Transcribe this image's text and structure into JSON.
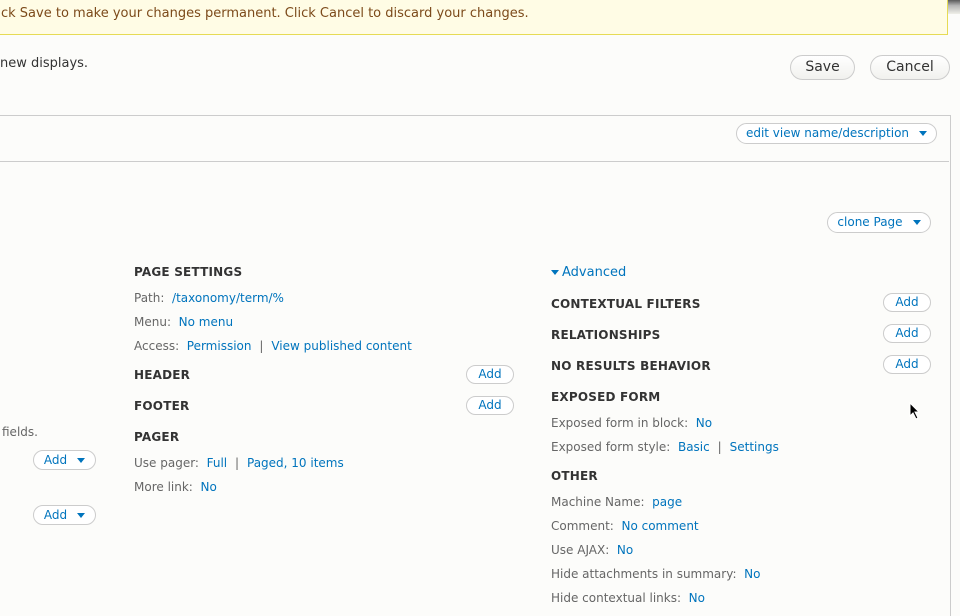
{
  "warning": "ck Save to make your changes permanent. Click Cancel to discard your changes.",
  "intro": "new displays.",
  "actions": {
    "save": "Save",
    "cancel": "Cancel"
  },
  "edit_view": "edit view name/description",
  "clone": "clone Page",
  "left": {
    "fields_text": "fields.",
    "add1": "Add",
    "add2": "Add"
  },
  "page_settings": {
    "title": "PAGE SETTINGS",
    "path_label": "Path:",
    "path": "/taxonomy/term/%",
    "menu_label": "Menu:",
    "menu": "No menu",
    "access_label": "Access:",
    "access1": "Permission",
    "access2": "View published content"
  },
  "header": {
    "title": "HEADER",
    "add": "Add"
  },
  "footer": {
    "title": "FOOTER",
    "add": "Add"
  },
  "pager": {
    "title": "PAGER",
    "use_label": "Use pager:",
    "use1": "Full",
    "use2": "Paged, 10 items",
    "more_label": "More link:",
    "more": "No"
  },
  "advanced": {
    "toggle": "Advanced",
    "contextual": {
      "title": "CONTEXTUAL FILTERS",
      "add": "Add"
    },
    "relationships": {
      "title": "RELATIONSHIPS",
      "add": "Add"
    },
    "noresults": {
      "title": "NO RESULTS BEHAVIOR",
      "add": "Add"
    },
    "exposed": {
      "title": "EXPOSED FORM",
      "block_label": "Exposed form in block:",
      "block": "No",
      "style_label": "Exposed form style:",
      "style": "Basic",
      "settings": "Settings"
    },
    "other": {
      "title": "OTHER",
      "machine_label": "Machine Name:",
      "machine": "page",
      "comment_label": "Comment:",
      "comment": "No comment",
      "ajax_label": "Use AJAX:",
      "ajax": "No",
      "hide_attach_label": "Hide attachments in summary:",
      "hide_attach": "No",
      "hide_ctx_label": "Hide contextual links:",
      "hide_ctx": "No"
    }
  }
}
